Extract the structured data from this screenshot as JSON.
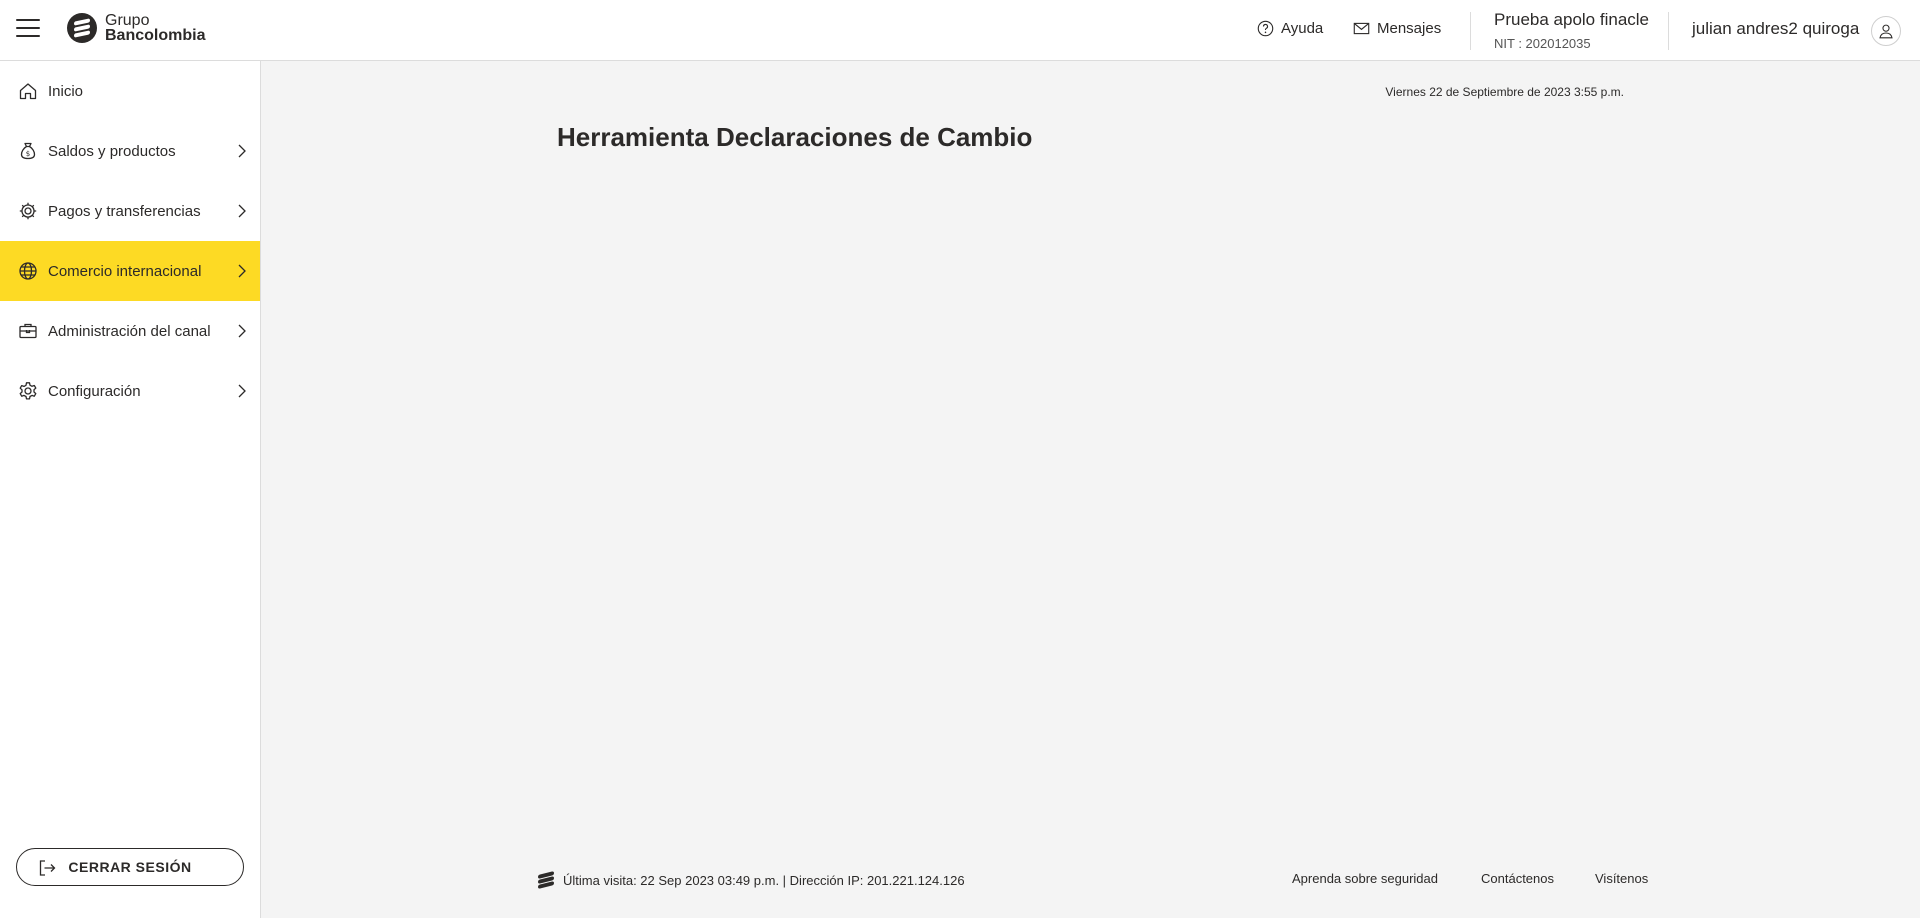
{
  "header": {
    "logo_line1": "Grupo",
    "logo_line2": "Bancolombia",
    "help_label": "Ayuda",
    "messages_label": "Mensajes",
    "company_name": "Prueba apolo finacle",
    "company_nit": "NIT : 202012035",
    "user_name": "julian andres2 quiroga"
  },
  "sidebar": {
    "items": [
      {
        "label": "Inicio",
        "icon": "home-icon",
        "has_chevron": false,
        "active": false
      },
      {
        "label": "Saldos y productos",
        "icon": "money-bag-icon",
        "has_chevron": true,
        "active": false
      },
      {
        "label": "Pagos y transferencias",
        "icon": "payments-gear-icon",
        "has_chevron": true,
        "active": false
      },
      {
        "label": "Comercio internacional",
        "icon": "globe-icon",
        "has_chevron": true,
        "active": true
      },
      {
        "label": "Administración del canal",
        "icon": "briefcase-icon",
        "has_chevron": true,
        "active": false
      },
      {
        "label": "Configuración",
        "icon": "gear-icon",
        "has_chevron": true,
        "active": false
      }
    ],
    "logout_label": "CERRAR SESIÓN"
  },
  "main": {
    "datetime": "Viernes 22 de Septiembre de 2023 3:55 p.m.",
    "title": "Herramienta Declaraciones de Cambio"
  },
  "footer": {
    "last_visit": "Última visita: 22 Sep 2023 03:49 p.m. | Dirección IP: 201.221.124.126",
    "links": [
      "Aprenda sobre seguridad",
      "Contáctenos",
      "Visítenos"
    ]
  },
  "colors": {
    "accent": "#fdda24",
    "text": "#2c2a29",
    "background": "#f4f4f4"
  }
}
